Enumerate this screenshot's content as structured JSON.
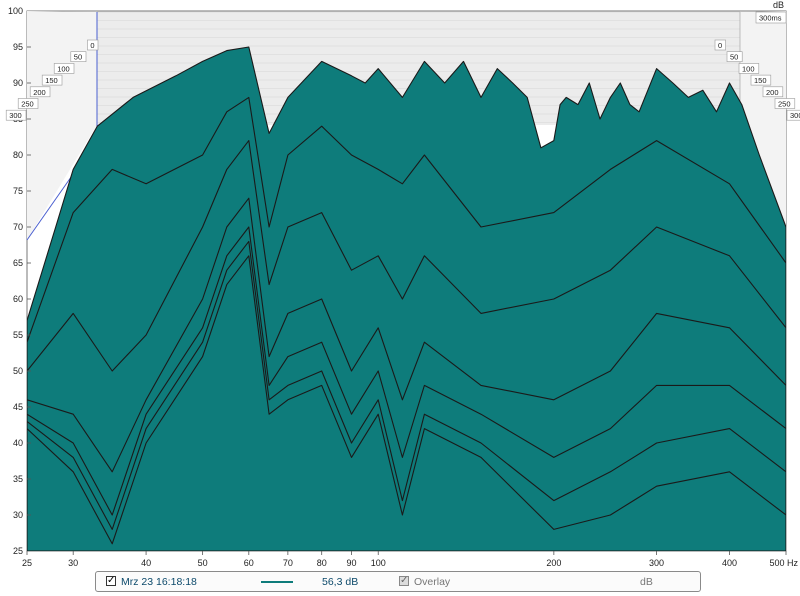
{
  "chart_data": {
    "type": "area",
    "style": "waterfall (cumulative spectral decay)",
    "xlabel_unit": "Hz",
    "ylabel_unit": "dB",
    "x_scale": "log",
    "xlim": [
      25,
      500
    ],
    "ylim": [
      25,
      100
    ],
    "x_ticks": [
      "25",
      "30",
      "40",
      "50",
      "60",
      "70",
      "80",
      "90",
      "100",
      "200",
      "300",
      "400",
      "500 Hz"
    ],
    "y_ticks": [
      "25",
      "30",
      "35",
      "40",
      "45",
      "50",
      "55",
      "60",
      "65",
      "70",
      "75",
      "80",
      "85",
      "90",
      "95",
      "100"
    ],
    "time_unit_label": "300ms",
    "time_ticks_ms": [
      0,
      50,
      100,
      150,
      200,
      250,
      300
    ],
    "fill_color": "#0e7c7b",
    "line_color": "#1a1a1a",
    "slices": [
      {
        "t_ms": 0,
        "x": [
          25,
          28,
          30,
          33,
          38,
          45,
          50,
          55,
          60,
          65,
          70,
          80,
          90,
          95,
          100,
          110,
          120,
          130,
          140,
          150,
          160,
          170,
          180,
          190,
          200,
          205,
          210,
          220,
          230,
          240,
          250,
          260,
          270,
          280,
          300,
          320,
          340,
          360,
          380,
          400,
          420,
          450,
          500
        ],
        "y": [
          57,
          70,
          78,
          84,
          88,
          91,
          93,
          94.5,
          95,
          83,
          88,
          93,
          91,
          90,
          92,
          88,
          93,
          90,
          93,
          88,
          92,
          90,
          88,
          81,
          82,
          87,
          88,
          87,
          90,
          85,
          88,
          90,
          87,
          86,
          92,
          90,
          88,
          89,
          86,
          90,
          87,
          80,
          70
        ]
      },
      {
        "t_ms": 50,
        "x": [
          25,
          30,
          35,
          40,
          50,
          55,
          60,
          65,
          70,
          80,
          90,
          100,
          110,
          120,
          150,
          200,
          250,
          300,
          400,
          500
        ],
        "y": [
          54,
          72,
          78,
          76,
          80,
          86,
          88,
          70,
          80,
          84,
          80,
          78,
          76,
          80,
          70,
          72,
          78,
          82,
          76,
          65
        ]
      },
      {
        "t_ms": 100,
        "x": [
          25,
          30,
          35,
          40,
          50,
          55,
          60,
          65,
          70,
          80,
          90,
          100,
          110,
          120,
          150,
          200,
          250,
          300,
          400,
          500
        ],
        "y": [
          50,
          58,
          50,
          55,
          70,
          78,
          82,
          62,
          70,
          72,
          64,
          66,
          60,
          66,
          58,
          60,
          64,
          70,
          66,
          56
        ]
      },
      {
        "t_ms": 150,
        "x": [
          25,
          30,
          35,
          40,
          50,
          55,
          60,
          65,
          70,
          80,
          90,
          100,
          110,
          120,
          150,
          200,
          250,
          300,
          400,
          500
        ],
        "y": [
          46,
          44,
          36,
          46,
          60,
          70,
          74,
          52,
          58,
          60,
          50,
          56,
          46,
          54,
          48,
          46,
          50,
          58,
          56,
          48
        ]
      },
      {
        "t_ms": 200,
        "x": [
          25,
          30,
          35,
          40,
          50,
          55,
          60,
          65,
          70,
          80,
          90,
          100,
          110,
          120,
          150,
          200,
          250,
          300,
          400,
          500
        ],
        "y": [
          44,
          40,
          30,
          44,
          56,
          66,
          70,
          48,
          52,
          54,
          44,
          50,
          38,
          48,
          44,
          38,
          42,
          48,
          48,
          42
        ]
      },
      {
        "t_ms": 250,
        "x": [
          25,
          30,
          35,
          40,
          50,
          55,
          60,
          65,
          70,
          80,
          90,
          100,
          110,
          120,
          150,
          200,
          250,
          300,
          400,
          500
        ],
        "y": [
          43,
          38,
          28,
          42,
          54,
          64,
          68,
          46,
          48,
          50,
          40,
          46,
          32,
          44,
          40,
          32,
          36,
          40,
          42,
          36
        ]
      },
      {
        "t_ms": 300,
        "x": [
          25,
          30,
          35,
          40,
          50,
          55,
          60,
          65,
          70,
          80,
          90,
          100,
          110,
          120,
          150,
          200,
          250,
          300,
          400,
          500
        ],
        "y": [
          42,
          36,
          26,
          40,
          52,
          62,
          66,
          44,
          46,
          48,
          38,
          44,
          30,
          42,
          38,
          28,
          30,
          34,
          36,
          30
        ]
      }
    ]
  },
  "legend": {
    "checked_mark": "✓",
    "measurement_name": "Mrz 23 16:18:18",
    "level": "56,3 dB",
    "overlay_label": "Overlay",
    "unit": "dB"
  }
}
